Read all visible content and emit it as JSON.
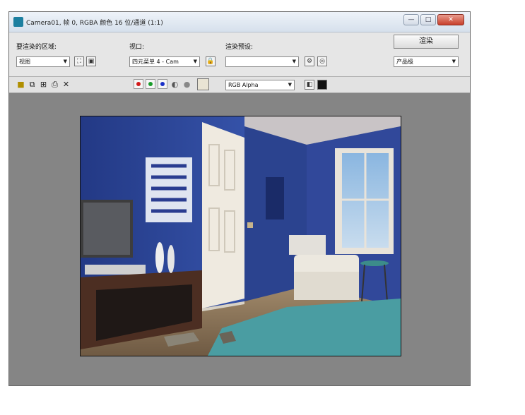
{
  "window": {
    "title": "Camera01, 帧 0, RGBA 颜色 16 位/通道 (1:1)",
    "minimize_label": "—",
    "maximize_label": "□",
    "close_label": "✕"
  },
  "toolbar": {
    "area_label": "要渲染的区域:",
    "area_value": "视图",
    "viewport_label": "视口:",
    "viewport_value": "四元菜单 4 - Cam",
    "preset_label": "渲染预设:",
    "preset_value": "",
    "render_button": "渲染",
    "production_value": "产品级"
  },
  "toolbar2": {
    "channel_value": "RGB Alpha"
  },
  "colors": {
    "red_channel": "#d21919",
    "green_channel": "#1a9c2b",
    "blue_channel": "#1a30c8",
    "swatch": "#e9e4d4"
  },
  "icons": [
    "save-image-icon",
    "copy-image-icon",
    "clone-window-icon",
    "print-icon",
    "clear-icon",
    "lock-icon",
    "environment-icon",
    "history-icon",
    "alpha-channel-icon",
    "monochrome-icon",
    "display-channel-icon",
    "toggle-ui-icon"
  ]
}
